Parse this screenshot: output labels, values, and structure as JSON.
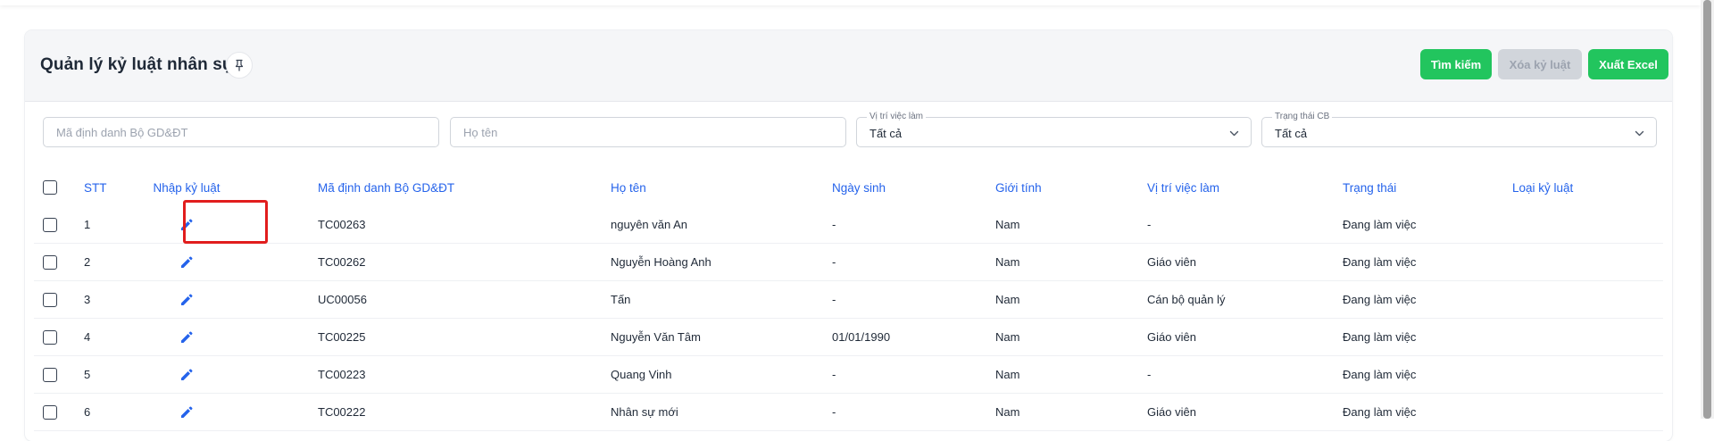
{
  "page": {
    "title": "Quản lý kỷ luật nhân sự"
  },
  "toolbar": {
    "search_label": "Tìm kiếm",
    "delete_label": "Xóa kỷ luật",
    "excel_label": "Xuất Excel"
  },
  "filters": {
    "code_placeholder": "Mã định danh Bộ GD&ĐT",
    "name_placeholder": "Họ tên",
    "position_label": "Vị trí việc làm",
    "position_value": "Tất cả",
    "status_label": "Trạng thái CB",
    "status_value": "Tất cả"
  },
  "table": {
    "headers": {
      "stt": "STT",
      "edit": "Nhập kỷ luật",
      "code": "Mã định danh Bộ GD&ĐT",
      "name": "Họ tên",
      "dob": "Ngày sinh",
      "gender": "Giới tính",
      "position": "Vị trí việc làm",
      "status": "Trạng thái",
      "type": "Loại kỷ luật"
    },
    "rows": [
      {
        "stt": "1",
        "code": "TC00263",
        "name": "nguyên văn An",
        "dob": "-",
        "gender": "Nam",
        "position": "-",
        "status": "Đang làm việc",
        "type": ""
      },
      {
        "stt": "2",
        "code": "TC00262",
        "name": "Nguyễn Hoàng Anh",
        "dob": "-",
        "gender": "Nam",
        "position": "Giáo viên",
        "status": "Đang làm việc",
        "type": ""
      },
      {
        "stt": "3",
        "code": "UC00056",
        "name": "Tấn",
        "dob": "-",
        "gender": "Nam",
        "position": "Cán bộ quản lý",
        "status": "Đang làm việc",
        "type": ""
      },
      {
        "stt": "4",
        "code": "TC00225",
        "name": "Nguyễn Văn Tâm",
        "dob": "01/01/1990",
        "gender": "Nam",
        "position": "Giáo viên",
        "status": "Đang làm việc",
        "type": ""
      },
      {
        "stt": "5",
        "code": "TC00223",
        "name": "Quang Vinh",
        "dob": "-",
        "gender": "Nam",
        "position": "-",
        "status": "Đang làm việc",
        "type": ""
      },
      {
        "stt": "6",
        "code": "TC00222",
        "name": "Nhân sự mới",
        "dob": "-",
        "gender": "Nam",
        "position": "Giáo viên",
        "status": "Đang làm việc",
        "type": ""
      }
    ]
  },
  "colors": {
    "accent": "#2563eb",
    "button_green": "#22c55e",
    "button_disabled": "#d1d5db",
    "highlight": "#e11d1d"
  },
  "icons": {
    "pin": "pin-icon",
    "edit": "pencil-icon",
    "dropdown": "chevron-down-icon"
  }
}
